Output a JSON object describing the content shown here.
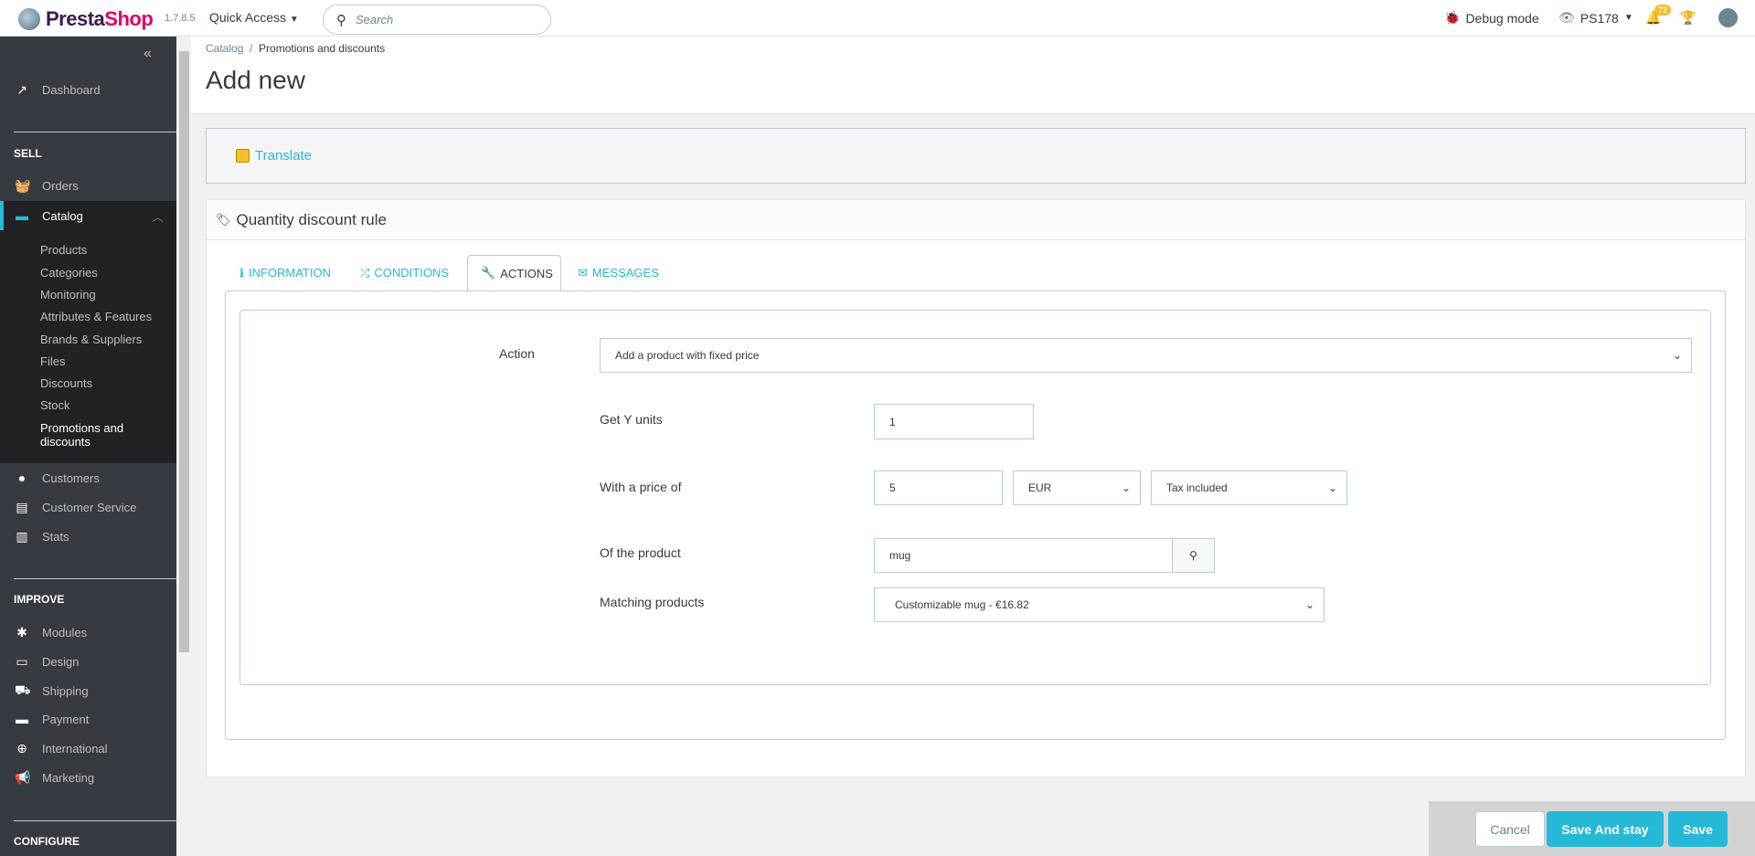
{
  "header": {
    "brand": "PrestaShop",
    "brand_a": "Presta",
    "brand_b": "Shop",
    "version": "1.7.8.5",
    "quick_access": "Quick Access",
    "search_placeholder": "Search",
    "debug": "Debug mode",
    "shop": "PS178",
    "notifications": "72"
  },
  "sidebar": {
    "dashboard": "Dashboard",
    "sell": "SELL",
    "orders": "Orders",
    "catalog": "Catalog",
    "catalog_sub": [
      "Products",
      "Categories",
      "Monitoring",
      "Attributes & Features",
      "Brands & Suppliers",
      "Files",
      "Discounts",
      "Stock",
      "Promotions and discounts"
    ],
    "customers": "Customers",
    "customer_service": "Customer Service",
    "stats": "Stats",
    "improve": "IMPROVE",
    "modules": "Modules",
    "design": "Design",
    "shipping": "Shipping",
    "payment": "Payment",
    "international": "International",
    "marketing": "Marketing",
    "configure": "CONFIGURE"
  },
  "breadcrumb": {
    "parent": "Catalog",
    "current": "Promotions and discounts"
  },
  "page_title": "Add new",
  "translate": "Translate",
  "panel": {
    "title": "Quantity discount rule",
    "tabs": [
      "INFORMATION",
      "CONDITIONS",
      "ACTIONS",
      "MESSAGES"
    ]
  },
  "form": {
    "action_label": "Action",
    "action_value": "Add a product with fixed price",
    "get_y_label": "Get Y units",
    "get_y_value": "1",
    "price_label": "With a price of",
    "price_value": "5",
    "currency": "EUR",
    "tax": "Tax included",
    "product_label": "Of the product",
    "product_value": "mug",
    "matching_label": "Matching products",
    "matching_value": "Customizable mug - €16.82"
  },
  "footer": {
    "cancel": "Cancel",
    "save_stay": "Save And stay",
    "save": "Save"
  },
  "colors": {
    "accent": "#25b9d7",
    "sidebar": "#363a41"
  }
}
